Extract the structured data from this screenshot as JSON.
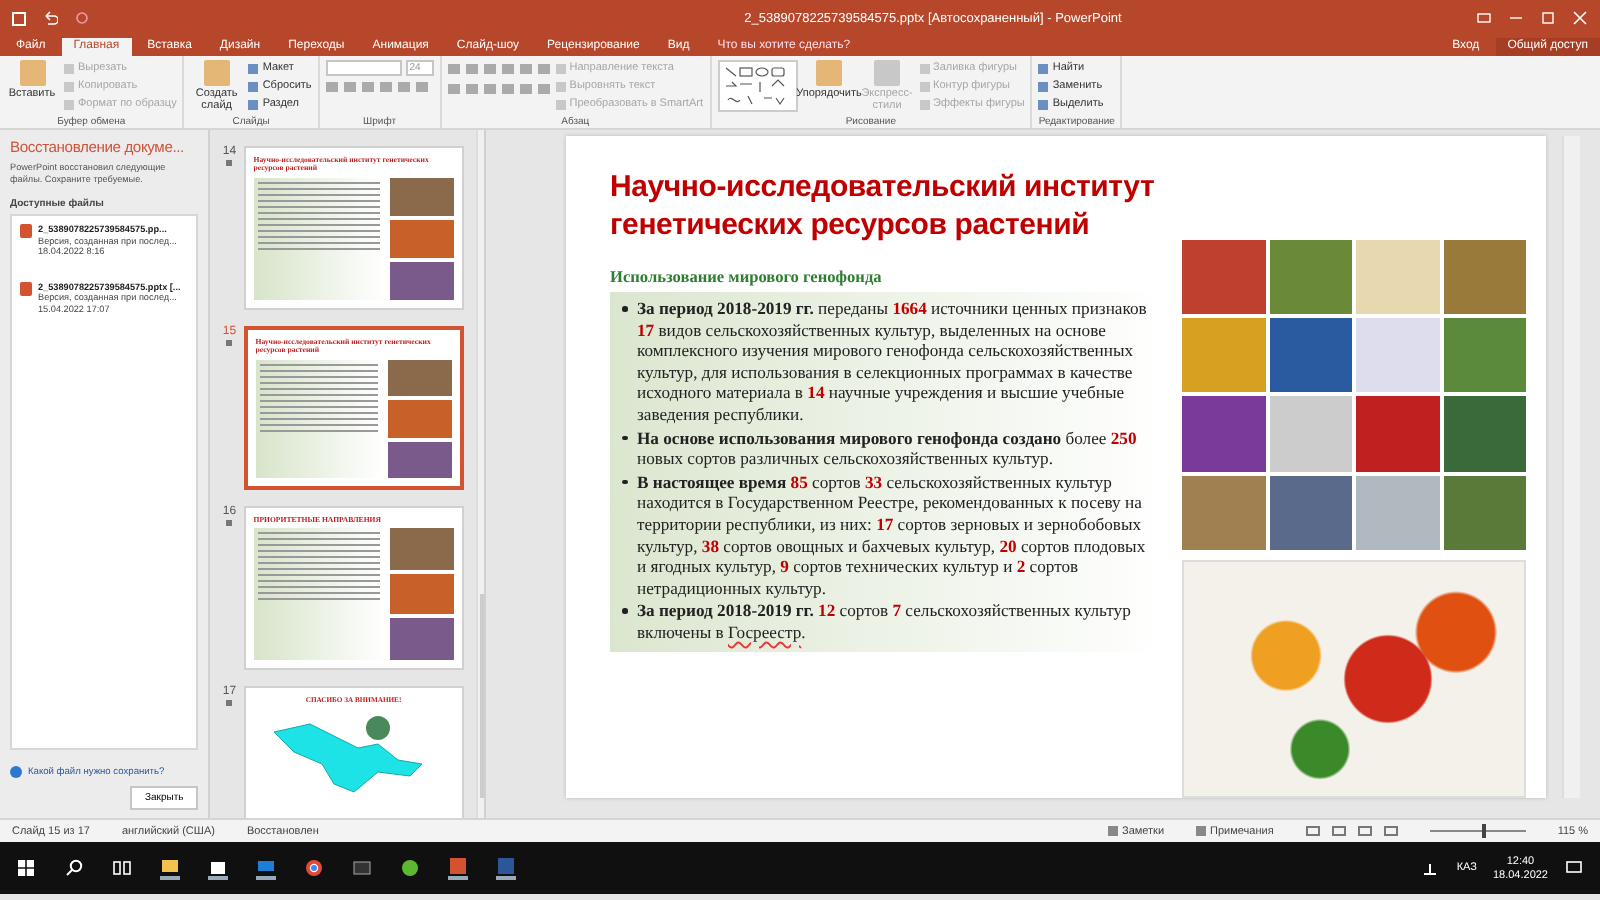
{
  "window": {
    "title": "2_5389078225739584575.pptx [Автосохраненный] - PowerPoint",
    "sign_in": "Вход",
    "share": "Общий доступ"
  },
  "tabs": [
    {
      "label": "Файл",
      "selected": false
    },
    {
      "label": "Главная",
      "selected": true
    },
    {
      "label": "Вставка",
      "selected": false
    },
    {
      "label": "Дизайн",
      "selected": false
    },
    {
      "label": "Переходы",
      "selected": false
    },
    {
      "label": "Анимация",
      "selected": false
    },
    {
      "label": "Слайд-шоу",
      "selected": false
    },
    {
      "label": "Рецензирование",
      "selected": false
    },
    {
      "label": "Вид",
      "selected": false
    }
  ],
  "tell_me": "Что вы хотите сделать?",
  "ribbon": {
    "groups": [
      {
        "label": "Буфер обмена",
        "columns": [
          [
            {
              "kind": "large",
              "label": "Вставить",
              "disabled": false
            }
          ],
          [
            {
              "kind": "small",
              "label": "Вырезать",
              "disabled": true
            },
            {
              "kind": "small",
              "label": "Копировать",
              "disabled": true
            },
            {
              "kind": "small",
              "label": "Формат по образцу",
              "disabled": true
            }
          ]
        ]
      },
      {
        "label": "Слайды",
        "columns": [
          [
            {
              "kind": "large",
              "label": "Создать слайд",
              "disabled": false
            }
          ],
          [
            {
              "kind": "small",
              "label": "Макет",
              "disabled": false
            },
            {
              "kind": "small",
              "label": "Сбросить",
              "disabled": false
            },
            {
              "kind": "small",
              "label": "Раздел",
              "disabled": false
            }
          ]
        ]
      },
      {
        "label": "Шрифт",
        "columns": [
          [
            {
              "kind": "font_box",
              "size": "24"
            },
            {
              "kind": "tools"
            }
          ]
        ]
      },
      {
        "label": "Абзац",
        "columns": [
          [
            {
              "kind": "tools"
            },
            {
              "kind": "tools"
            }
          ],
          [
            {
              "kind": "small",
              "label": "Направление текста",
              "disabled": true
            },
            {
              "kind": "small",
              "label": "Выровнять текст",
              "disabled": true
            },
            {
              "kind": "small",
              "label": "Преобразовать в SmartArt",
              "disabled": true
            }
          ]
        ]
      },
      {
        "label": "Рисование",
        "columns": [
          [
            {
              "kind": "gallery"
            }
          ],
          [
            {
              "kind": "large",
              "label": "Упорядочить",
              "disabled": false
            }
          ],
          [
            {
              "kind": "large",
              "label": "Экспресс-стили",
              "disabled": true
            }
          ],
          [
            {
              "kind": "small",
              "label": "Заливка фигуры",
              "disabled": true
            },
            {
              "kind": "small",
              "label": "Контур фигуры",
              "disabled": true
            },
            {
              "kind": "small",
              "label": "Эффекты фигуры",
              "disabled": true
            }
          ]
        ]
      },
      {
        "label": "Редактирование",
        "columns": [
          [
            {
              "kind": "small",
              "label": "Найти",
              "disabled": false
            },
            {
              "kind": "small",
              "label": "Заменить",
              "disabled": false
            },
            {
              "kind": "small",
              "label": "Выделить",
              "disabled": false
            }
          ]
        ]
      }
    ]
  },
  "recovery": {
    "title": "Восстановление докуме...",
    "message": "PowerPoint восстановил следующие файлы. Сохраните требуемые.",
    "list_label": "Доступные файлы",
    "files": [
      {
        "name": "2_5389078225739584575.pp...",
        "note": "Версия, созданная при послед...",
        "date": "18.04.2022 8:16"
      },
      {
        "name": "2_5389078225739584575.pptx [...",
        "note": "Версия, созданная при послед...",
        "date": "15.04.2022 17:07"
      }
    ],
    "help": "Какой файл нужно сохранить?",
    "close": "Закрыть"
  },
  "thumbnails": [
    {
      "number": "14",
      "kind": "text_photos",
      "title": "Научно-исследовательский институт генетических ресурсов растений",
      "selected": false
    },
    {
      "number": "15",
      "kind": "text_photos",
      "title": "Научно-исследовательский институт генетических ресурсов растений",
      "selected": true
    },
    {
      "number": "16",
      "kind": "text_photos",
      "title": "ПРИОРИТЕТНЫЕ НАПРАВЛЕНИЯ",
      "selected": false
    },
    {
      "number": "17",
      "kind": "map",
      "title": "СПАСИБО ЗА ВНИМАНИЕ!",
      "selected": false
    }
  ],
  "slide": {
    "title": "Научно-исследовательский институт генетических ресурсов растений",
    "subtitle": "Использование мирового генофонда",
    "bullets": [
      [
        {
          "kind": "bold",
          "text": "За период 2018-2019 гг."
        },
        {
          "kind": "plain",
          "text": " переданы "
        },
        {
          "kind": "number",
          "text": "1664"
        },
        {
          "kind": "plain",
          "text": " источники ценных признаков "
        },
        {
          "kind": "number",
          "text": "17"
        },
        {
          "kind": "plain",
          "text": " видов сельскохозяйственных культур, выделенных на основе комплексного изучения мирового генофонда сельскохозяйственных культур, для использования в селекционных программах в качестве исходного материала в "
        },
        {
          "kind": "number",
          "text": "14"
        },
        {
          "kind": "plain",
          "text": " научные учреждения и высшие учебные заведения республики."
        }
      ],
      [
        {
          "kind": "bold",
          "text": "На основе использования мирового генофонда создано"
        },
        {
          "kind": "plain",
          "text": " более "
        },
        {
          "kind": "number",
          "text": "250"
        },
        {
          "kind": "plain",
          "text": " новых сортов различных сельскохозяйственных культур."
        }
      ],
      [
        {
          "kind": "bold",
          "text": "В настоящее время "
        },
        {
          "kind": "number",
          "text": "85"
        },
        {
          "kind": "plain",
          "text": " сортов "
        },
        {
          "kind": "number",
          "text": "33"
        },
        {
          "kind": "plain",
          "text": " сельскохозяйственных культур находится в Государственном Реестре, рекомендованных к посеву на территории республики, из них: "
        },
        {
          "kind": "number",
          "text": "17"
        },
        {
          "kind": "plain",
          "text": " сортов зерновых и зернобобовых культур, "
        },
        {
          "kind": "number",
          "text": "38"
        },
        {
          "kind": "plain",
          "text": " сортов овощных и бахчевых культур, "
        },
        {
          "kind": "number",
          "text": "20"
        },
        {
          "kind": "plain",
          "text": " сортов плодовых и ягодных культур, "
        },
        {
          "kind": "number",
          "text": "9"
        },
        {
          "kind": "plain",
          "text": " сортов технических культур и "
        },
        {
          "kind": "number",
          "text": "2"
        },
        {
          "kind": "plain",
          "text": " сортов нетрадиционных культур."
        }
      ],
      [
        {
          "kind": "bold",
          "text": "За период 2018-2019 гг. "
        },
        {
          "kind": "number",
          "text": "12"
        },
        {
          "kind": "plain",
          "text": " сортов "
        },
        {
          "kind": "number",
          "text": "7"
        },
        {
          "kind": "plain",
          "text": " сельскохозяйственных культур включены в "
        },
        {
          "kind": "flagged",
          "text": "Госреестр"
        },
        {
          "kind": "plain",
          "text": "."
        }
      ]
    ]
  },
  "status_bar": {
    "slide": "Слайд 15 из 17",
    "language": "английский (США)",
    "state": "Восстановлен",
    "notes": "Заметки",
    "comments": "Примечания",
    "zoom": {
      "level": 0.55,
      "reading": "115 %"
    }
  },
  "taskbar": {
    "language": "КАЗ",
    "time": "12:40",
    "date": "18.04.2022"
  }
}
